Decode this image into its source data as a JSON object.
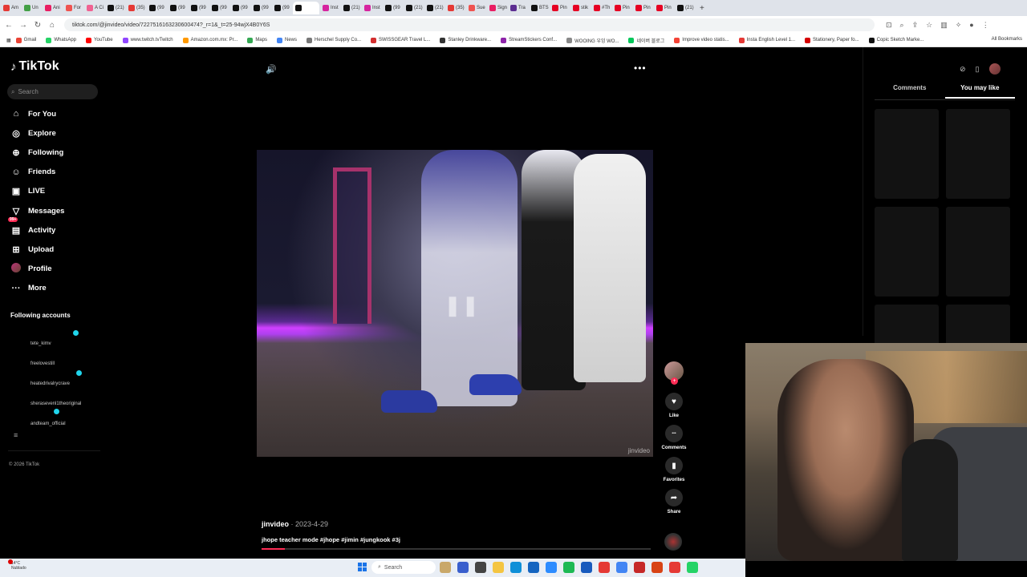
{
  "browser": {
    "tabs": [
      {
        "label": "Am",
        "color": "#e53935"
      },
      {
        "label": "Un",
        "color": "#43a047"
      },
      {
        "label": "Ani",
        "color": "#e91e63"
      },
      {
        "label": "For",
        "color": "#ef5350"
      },
      {
        "label": "A Ci",
        "color": "#f06292"
      },
      {
        "label": "(21)",
        "color": "#111111"
      },
      {
        "label": "(35)",
        "color": "#e53935"
      },
      {
        "label": "(99",
        "color": "#111111"
      },
      {
        "label": "(99",
        "color": "#111111"
      },
      {
        "label": "(99",
        "color": "#111111"
      },
      {
        "label": "(99",
        "color": "#111111"
      },
      {
        "label": "(99",
        "color": "#111111"
      },
      {
        "label": "(99",
        "color": "#111111"
      },
      {
        "label": "(99",
        "color": "#111111"
      },
      {
        "label": "",
        "color": "#111111",
        "active": true
      },
      {
        "label": "Inst",
        "color": "#d6249f"
      },
      {
        "label": "(21)",
        "color": "#111111"
      },
      {
        "label": "Inst",
        "color": "#d6249f"
      },
      {
        "label": "(99",
        "color": "#111111"
      },
      {
        "label": "(21)",
        "color": "#111111"
      },
      {
        "label": "(21)",
        "color": "#111111"
      },
      {
        "label": "(35)",
        "color": "#e53935"
      },
      {
        "label": "Sue",
        "color": "#ef5350"
      },
      {
        "label": "Sign",
        "color": "#e91e63"
      },
      {
        "label": "Tra",
        "color": "#5c2d91"
      },
      {
        "label": "BTS",
        "color": "#111111"
      },
      {
        "label": "Pin",
        "color": "#e60023"
      },
      {
        "label": "stik",
        "color": "#e60023"
      },
      {
        "label": "#Th",
        "color": "#e60023"
      },
      {
        "label": "Pin",
        "color": "#e60023"
      },
      {
        "label": "Pin",
        "color": "#e60023"
      },
      {
        "label": "Pin",
        "color": "#e60023"
      },
      {
        "label": "(21)",
        "color": "#111111"
      }
    ],
    "new_tab": "+",
    "url": "tiktok.com/@jinvideo/video/7227516163230600474?_r=1&_t=25-94wjX4B0Y6S",
    "bookmarks": [
      {
        "label": "Gmail",
        "color": "#ea4335"
      },
      {
        "label": "WhatsApp",
        "color": "#25d366"
      },
      {
        "label": "YouTube",
        "color": "#ff0000"
      },
      {
        "label": "www.twitch.tvTwitch",
        "color": "#9146ff"
      },
      {
        "label": "Amazon.com.mx: Pr...",
        "color": "#ff9900"
      },
      {
        "label": "Maps",
        "color": "#34a853"
      },
      {
        "label": "News",
        "color": "#4285f4"
      },
      {
        "label": "Herschel Supply Co...",
        "color": "#777777"
      },
      {
        "label": "SWISSGEAR Travel L...",
        "color": "#d32f2f"
      },
      {
        "label": "Stanley Drinkware...",
        "color": "#333333"
      },
      {
        "label": "StreamStickers Conf...",
        "color": "#8e24aa"
      },
      {
        "label": "WOOING 우잉 WO...",
        "color": "#888888"
      },
      {
        "label": "네이버 블로그",
        "color": "#03c75a"
      },
      {
        "label": "Improve video statis...",
        "color": "#f44336"
      },
      {
        "label": "Insta English Level 1...",
        "color": "#e53935"
      },
      {
        "label": "Stationery, Paper fo...",
        "color": "#d50000"
      },
      {
        "label": "Copic Sketch Marke...",
        "color": "#111111"
      }
    ],
    "all_bookmarks": "All Bookmarks"
  },
  "sidebar": {
    "logo": "TikTok",
    "search_placeholder": "Search",
    "nav": [
      {
        "label": "For You",
        "icon": "home-icon",
        "glyph": "⌂"
      },
      {
        "label": "Explore",
        "icon": "compass-icon",
        "glyph": "◎"
      },
      {
        "label": "Following",
        "icon": "following-icon",
        "glyph": "⊕"
      },
      {
        "label": "Friends",
        "icon": "friends-icon",
        "glyph": "☺"
      },
      {
        "label": "LIVE",
        "icon": "live-icon",
        "glyph": "▣"
      },
      {
        "label": "Messages",
        "icon": "messages-icon",
        "glyph": "▽"
      },
      {
        "label": "Activity",
        "icon": "activity-icon",
        "glyph": "▤",
        "badge": "99+"
      },
      {
        "label": "Upload",
        "icon": "upload-icon",
        "glyph": "⊞"
      },
      {
        "label": "Profile",
        "icon": "profile-avatar",
        "glyph": ""
      },
      {
        "label": "More",
        "icon": "more-icon",
        "glyph": "···"
      }
    ],
    "following_heading": "Following accounts",
    "accounts": [
      {
        "name": "tete_kimv",
        "live": true
      },
      {
        "name": "freelovestill",
        "live": false
      },
      {
        "name": "heatedrivalrycrave",
        "live": true
      },
      {
        "name": "sherasevenl1theoriginal",
        "live": false
      },
      {
        "name": "andteam_official",
        "live": true
      }
    ],
    "copyright": "© 2026 TikTok"
  },
  "video": {
    "watermark": "jinvideo",
    "username": "jinvideo",
    "date": " · 2023-4-29",
    "caption": "jhope teacher mode  #jhope #jimin #jungkook #3j",
    "progress": 0.06
  },
  "actions": [
    {
      "label": "Like",
      "icon": "heart-icon",
      "glyph": "♥"
    },
    {
      "label": "Comments",
      "icon": "comment-icon",
      "glyph": "•••"
    },
    {
      "label": "Favorites",
      "icon": "bookmark-icon",
      "glyph": "▮"
    },
    {
      "label": "Share",
      "icon": "share-icon",
      "glyph": "➦"
    }
  ],
  "right_panel": {
    "tabs": [
      {
        "label": "Comments",
        "selected": false
      },
      {
        "label": "You may like",
        "selected": true
      }
    ]
  },
  "taskbar": {
    "temp": "14°C",
    "weather": "Nublado",
    "search": "Search"
  }
}
